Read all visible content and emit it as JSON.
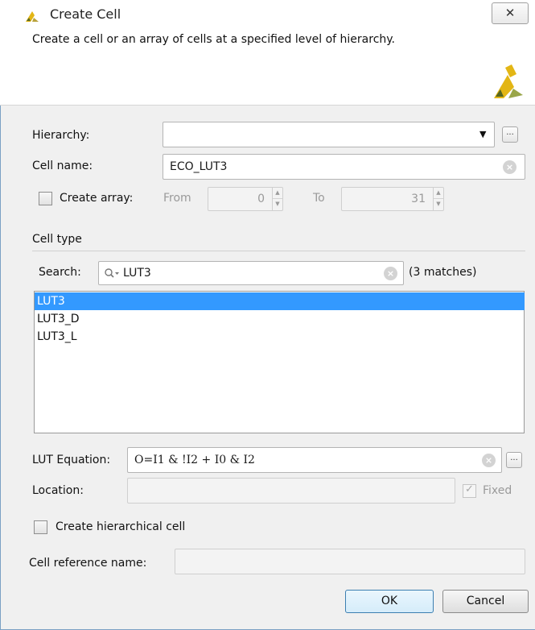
{
  "window": {
    "title": "Create Cell",
    "close_glyph": "✕"
  },
  "header": {
    "description": "Create a cell or an array of cells at a specified level of hierarchy."
  },
  "form": {
    "hierarchy_label": "Hierarchy:",
    "hierarchy_value": "",
    "browse_glyph": "...",
    "cell_name_label": "Cell name:",
    "cell_name_value": "ECO_LUT3",
    "create_array_label": "Create array:",
    "create_array_checked": false,
    "from_label": "From",
    "from_value": "0",
    "to_label": "To",
    "to_value": "31"
  },
  "cell_type": {
    "section_label": "Cell type",
    "search_label": "Search:",
    "search_value": "LUT3",
    "match_count": "(3 matches)",
    "items": [
      "LUT3",
      "LUT3_D",
      "LUT3_L"
    ],
    "selected_item": "LUT3"
  },
  "lut": {
    "equation_label": "LUT Equation:",
    "equation_value": "O=I1 & !I2 + I0 & I2",
    "location_label": "Location:",
    "location_value": "",
    "fixed_label": "Fixed",
    "fixed_checked": true
  },
  "hier": {
    "create_hier_label": "Create hierarchical cell",
    "create_hier_checked": false,
    "ref_name_label": "Cell reference name:",
    "ref_name_value": ""
  },
  "buttons": {
    "ok": "OK",
    "cancel": "Cancel"
  },
  "colors": {
    "selection": "#3399ff",
    "logo": "#e3b615",
    "window_border": "#7aa0c4"
  },
  "icons": {
    "app_logo": "xilinx-logo-icon",
    "search": "magnifier-icon",
    "clear": "clear-x-icon",
    "dropdown": "triangle-down-icon"
  }
}
